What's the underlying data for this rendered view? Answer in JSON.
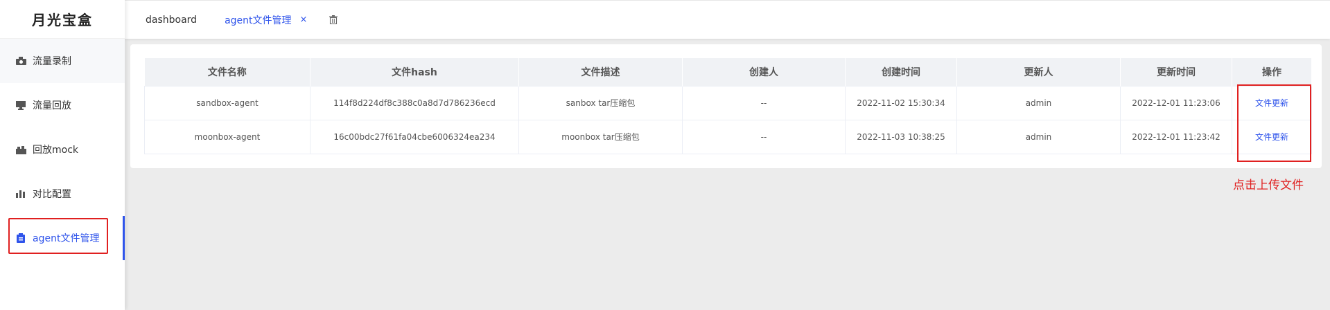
{
  "sidebar": {
    "logo": "月光宝盒",
    "items": [
      {
        "label": "流量录制",
        "icon": "camera-icon"
      },
      {
        "label": "流量回放",
        "icon": "monitor-icon"
      },
      {
        "label": "回放mock",
        "icon": "mock-icon"
      },
      {
        "label": "对比配置",
        "icon": "bar-chart-icon"
      },
      {
        "label": "agent文件管理",
        "icon": "clipboard-icon"
      }
    ],
    "active_index": 4
  },
  "tabs": [
    {
      "label": "dashboard",
      "active": false
    },
    {
      "label": "agent文件管理",
      "active": true,
      "close": "×"
    }
  ],
  "table": {
    "headers": [
      "文件名称",
      "文件hash",
      "文件描述",
      "创建人",
      "创建时间",
      "更新人",
      "更新时间",
      "操作"
    ],
    "rows": [
      [
        "sandbox-agent",
        "114f8d224df8c388c0a8d7d786236ecd",
        "sanbox tar压缩包",
        "--",
        "2022-11-02 15:30:34",
        "admin",
        "2022-12-01 11:23:06",
        "文件更新"
      ],
      [
        "moonbox-agent",
        "16c00bdc27f61fa04cbe6006324ea234",
        "moonbox tar压缩包",
        "--",
        "2022-11-03 10:38:25",
        "admin",
        "2022-12-01 11:23:42",
        "文件更新"
      ]
    ]
  },
  "annotation": "点击上传文件",
  "colors": {
    "accent": "#2f54eb",
    "highlight": "#e02020",
    "background": "#ececec"
  }
}
